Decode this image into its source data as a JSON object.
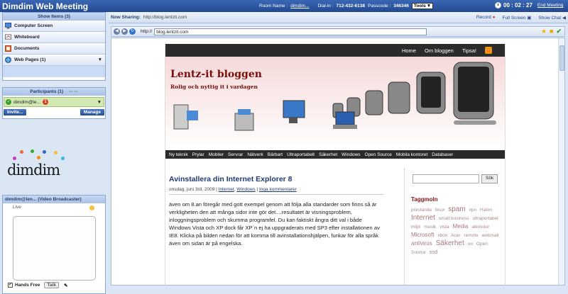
{
  "app": {
    "title": "Dimdim Web Meeting",
    "room_label": "Room Name :",
    "room_value": "dimdim...",
    "dialin_label": "Dial-in :",
    "dialin_value": "712-432-6138",
    "passcode_label": "Passcode :",
    "passcode_value": "346346",
    "tools_label": "Tools",
    "timer": "00 : 02 : 27",
    "end_meeting": "End Meeting"
  },
  "sidebar": {
    "show_items": "Show Items (3)",
    "items": [
      {
        "label": "Computer Screen",
        "icon": "monitor-icon"
      },
      {
        "label": "Whiteboard",
        "icon": "whiteboard-icon"
      },
      {
        "label": "Documents",
        "icon": "documents-icon"
      },
      {
        "label": "Web Pages (1)",
        "icon": "globe-icon"
      }
    ],
    "participants": "Participants (1)",
    "participant_name": "dimdim@le...",
    "participant_badge": "1",
    "invite": "Invite...",
    "manage": "Manage",
    "logo_text": "dimdim",
    "video_title": "dimdim@len... (Video Broadcaster)",
    "live": "Live",
    "hands_free": "Hands Free",
    "talk": "Talk"
  },
  "share": {
    "label": "Now Sharing:",
    "url": "http://blog.lentzit.com",
    "record": "Record",
    "full_screen": "Full Screen",
    "show_chat": "Show Chat"
  },
  "browser": {
    "scheme": "http://",
    "address": "blog.lentzit.com"
  },
  "blog": {
    "nav": [
      "Home",
      "Om bloggen",
      "Tipsa!"
    ],
    "title": "Lentz-it bloggen",
    "subtitle": "Rolig och nyttig it i vardagen",
    "categories": [
      "Ny teknik",
      "Prylar",
      "Mobiler",
      "Servrar",
      "Nätverk",
      "Bärbart",
      "Ultraportabelt",
      "Säkerhet",
      "Windows",
      "Open Source",
      "Mobila kontoret",
      "Databaser"
    ],
    "post_title": "Avinstallera din Internet Explorer 8",
    "post_date": "onsdag, juni 3rd, 2009 |",
    "post_cat1": "Internet",
    "post_cat2": "Windows",
    "post_comments": "Inga kommentarer",
    "post_body": "även om 8.an föregår med gott exempel genom att följa alla standarder som finns så är verkligheten den att många sidor inte gör det....resultatet är visningsproblem, inloggningsproblem och skumma programfel. Du kan faktiskt ångra ditt val i både Windows Vista och XP dock får XP´n ej ha uppgraderats med SP3 efter installationen av IE8. Klicka på bilden nedan för att komma till avinstallationshjälpen, funkar för alla språk även om sidan är på engelska.",
    "search_button": "Sök",
    "tag_heading": "Taggmoln",
    "tags": [
      "prestanda",
      "linux",
      "spam",
      "vpn",
      "Halon",
      "Internet",
      "small business",
      "ultraportabel",
      "miljö",
      "musik",
      "vista",
      "Media",
      "alkmotor",
      "Microsoft",
      "xbox",
      "Acer",
      "remote",
      "webmail",
      "antivirus",
      "Säkerhet",
      "uo",
      "Open Source",
      "ssd"
    ]
  }
}
